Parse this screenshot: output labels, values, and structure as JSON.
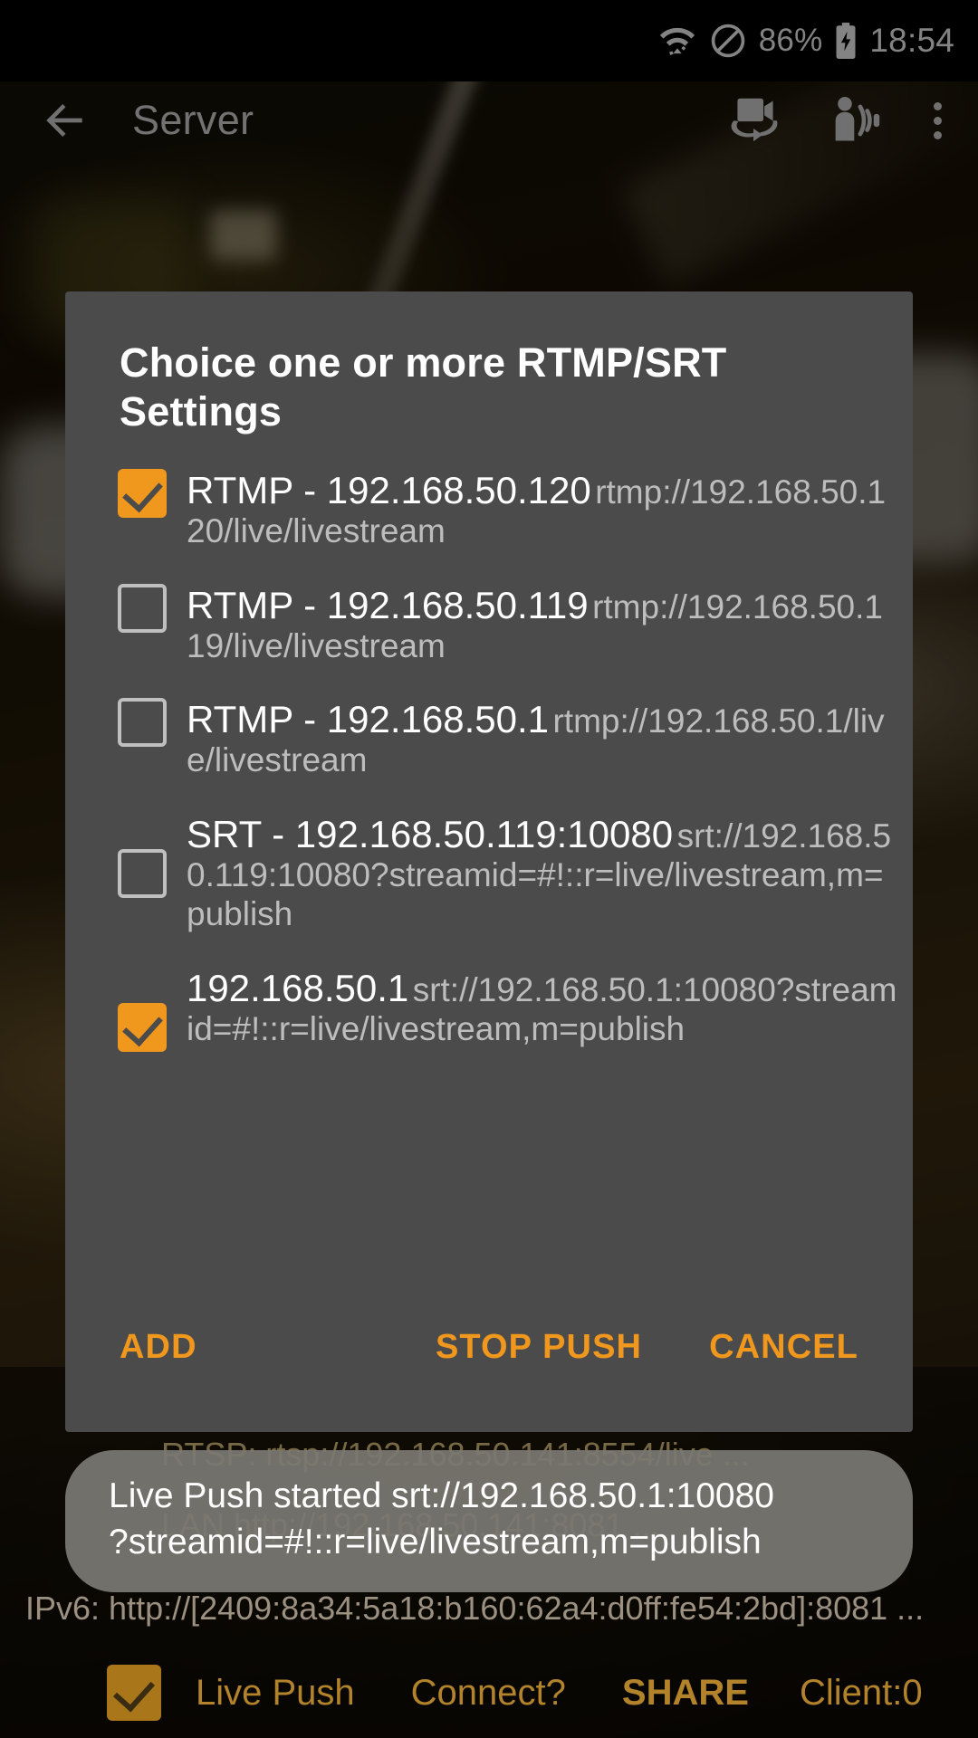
{
  "status_bar": {
    "wifi_icon": "wifi-icon",
    "dnd_icon": "do-not-disturb-icon",
    "battery_percent": "86%",
    "battery_icon": "battery-charging-icon",
    "clock": "18:54"
  },
  "app_bar": {
    "back_icon": "back-arrow-icon",
    "title": "Server",
    "switch_camera_icon": "switch-camera-icon",
    "audio_person_icon": "person-audio-icon",
    "overflow_icon": "more-vertical-icon"
  },
  "dialog": {
    "title": "Choice one or more RTMP/SRT Settings",
    "options": [
      {
        "checked": true,
        "title": "RTMP - 192.168.50.120",
        "subtitle": "rtmp://192.168.50.120/live/livestream"
      },
      {
        "checked": false,
        "title": "RTMP - 192.168.50.119",
        "subtitle": "rtmp://192.168.50.119/live/livestream"
      },
      {
        "checked": false,
        "title": "RTMP - 192.168.50.1",
        "subtitle": "rtmp://192.168.50.1/live/livestream"
      },
      {
        "checked": false,
        "title": "SRT - 192.168.50.119:10080",
        "subtitle": "srt://192.168.50.119:10080?streamid=#!::r=live/livestream,m=publish"
      },
      {
        "checked": true,
        "title": "192.168.50.1",
        "subtitle": "srt://192.168.50.1:10080?streamid=#!::r=live/livestream,m=publish"
      }
    ],
    "actions": {
      "add": "ADD",
      "stop_push": "STOP PUSH",
      "cancel": "CANCEL"
    }
  },
  "toast": {
    "message": "Live Push started srt://192.168.50.1:10080\n?streamid=#!::r=live/livestream,m=publish"
  },
  "background_info": {
    "rtsp": "RTSP: rtsp://192.168.50.141:8554/live ...",
    "lan": "LAN http://192.168.50.141:8081 ...",
    "ipv6": "IPv6: http://[2409:8a34:5a18:b160:62a4:d0ff:fe54:2bd]:8081 ..."
  },
  "bottom_bar": {
    "live_push_checked": true,
    "live_push": "Live Push",
    "connect": "Connect?",
    "share": "SHARE",
    "client": "Client:0"
  },
  "colors": {
    "accent": "#f0971e",
    "dialog_bg": "#4b4b4b",
    "subtitle": "#bdbdbd",
    "bottom_bar_text": "#b2832a"
  }
}
